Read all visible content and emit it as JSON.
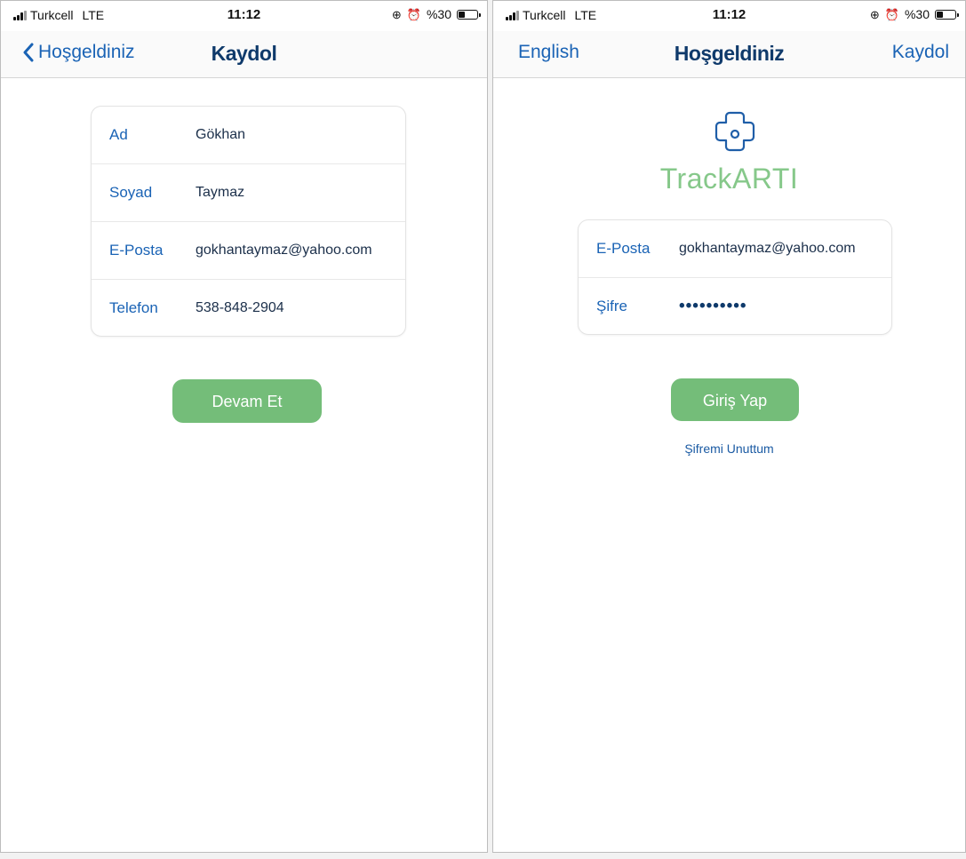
{
  "status_bar": {
    "carrier": "Turkcell",
    "network": "LTE",
    "time": "11:12",
    "battery": "%30",
    "battery_level_percent": 30
  },
  "signup_screen": {
    "nav": {
      "back_label": "Hoşgeldiniz",
      "title": "Kaydol"
    },
    "fields": [
      {
        "label": "Ad",
        "value": "Gökhan"
      },
      {
        "label": "Soyad",
        "value": "Taymaz"
      },
      {
        "label": "E-Posta",
        "value": "gokhantaymaz@yahoo.com"
      },
      {
        "label": "Telefon",
        "value": "538-848-2904"
      }
    ],
    "continue_label": "Devam Et"
  },
  "login_screen": {
    "nav": {
      "left_label": "English",
      "title": "Hoşgeldiniz",
      "right_label": "Kaydol"
    },
    "brand": "TrackARTI",
    "fields": [
      {
        "label": "E-Posta",
        "value": "gokhantaymaz@yahoo.com"
      },
      {
        "label": "Şifre",
        "value": "••••••••••"
      }
    ],
    "login_label": "Giriş Yap",
    "forgot_label": "Şifremi Unuttum"
  },
  "colors": {
    "accent_blue": "#1a63b5",
    "title_navy": "#0f3a6b",
    "button_green": "#74bd79",
    "brand_green": "#86c88a"
  }
}
